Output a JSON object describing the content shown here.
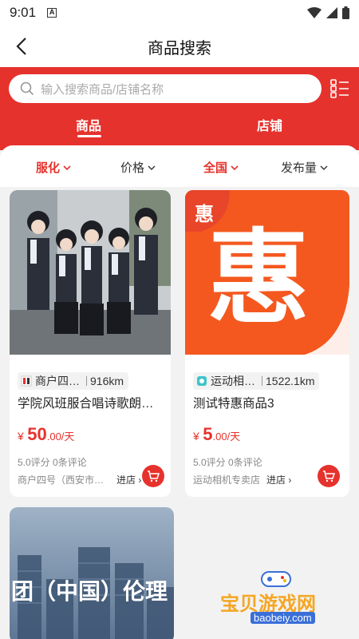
{
  "status_bar": {
    "time": "9:01",
    "sim_label": "A"
  },
  "nav": {
    "title": "商品搜索"
  },
  "search": {
    "placeholder": "输入搜索商品/店铺名称"
  },
  "tabs": [
    {
      "label": "商品",
      "active": true
    },
    {
      "label": "店铺",
      "active": false
    }
  ],
  "filters": [
    {
      "label": "服化",
      "active": true
    },
    {
      "label": "价格",
      "active": false
    },
    {
      "label": "全国",
      "active": true
    },
    {
      "label": "发布量",
      "active": false
    }
  ],
  "products": [
    {
      "shop_short": "商户四…",
      "distance": "916km",
      "name": "学院风班服合唱诗歌朗…",
      "currency": "¥",
      "price_int": "50",
      "price_dec": ".00/天",
      "rating": "5.0评分 0条评论",
      "shop_full": "商户四号（西安市…",
      "enter_label": "进店",
      "enter_arrow": "›"
    },
    {
      "shop_short": "运动相…",
      "distance": "1522.1km",
      "name": "测试特惠商品3",
      "image_text": "惠",
      "currency": "¥",
      "price_int": "5",
      "price_dec": ".00/天",
      "rating": "5.0评分 0条评论",
      "shop_full": "运动相机专卖店",
      "enter_label": "进店",
      "enter_arrow": "›"
    },
    {
      "image_text": "团（中国）伦理"
    }
  ],
  "watermark": {
    "title": "宝贝游戏网",
    "url": "baobeiy.com"
  },
  "colors": {
    "brand_red": "#e6322d",
    "orange": "#f4581f"
  }
}
